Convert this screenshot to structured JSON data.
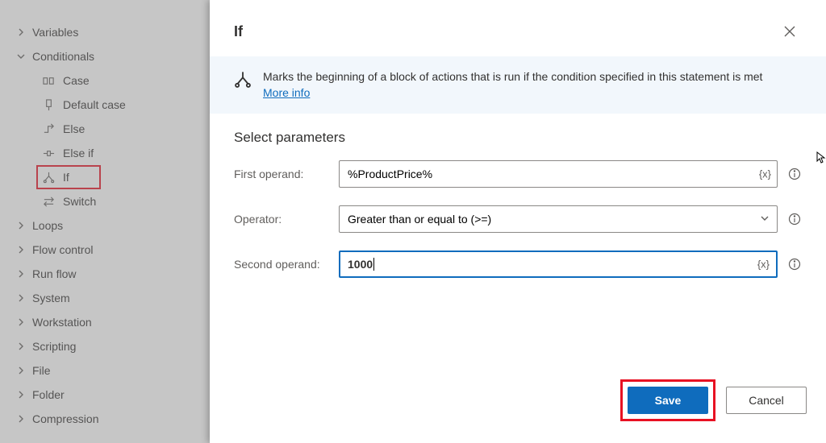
{
  "sidebar": {
    "items": [
      {
        "label": "Variables",
        "expanded": false
      },
      {
        "label": "Conditionals",
        "expanded": true,
        "children": [
          {
            "label": "Case",
            "icon": "case"
          },
          {
            "label": "Default case",
            "icon": "default"
          },
          {
            "label": "Else",
            "icon": "else"
          },
          {
            "label": "Else if",
            "icon": "elseif"
          },
          {
            "label": "If",
            "icon": "if",
            "highlight": true
          },
          {
            "label": "Switch",
            "icon": "switch"
          }
        ]
      },
      {
        "label": "Loops",
        "expanded": false
      },
      {
        "label": "Flow control",
        "expanded": false
      },
      {
        "label": "Run flow",
        "expanded": false
      },
      {
        "label": "System",
        "expanded": false
      },
      {
        "label": "Workstation",
        "expanded": false
      },
      {
        "label": "Scripting",
        "expanded": false
      },
      {
        "label": "File",
        "expanded": false
      },
      {
        "label": "Folder",
        "expanded": false
      },
      {
        "label": "Compression",
        "expanded": false
      }
    ]
  },
  "panel": {
    "title": "If",
    "description": "Marks the beginning of a block of actions that is run if the condition specified in this statement is met",
    "more_link": "More info",
    "section_title": "Select parameters",
    "fields": {
      "first_operand": {
        "label": "First operand:",
        "value": "%ProductPrice%",
        "badge": "{x}"
      },
      "operator": {
        "label": "Operator:",
        "value": "Greater than or equal to (>=)"
      },
      "second_operand": {
        "label": "Second operand:",
        "value": "1000",
        "badge": "{x}"
      }
    },
    "buttons": {
      "save": "Save",
      "cancel": "Cancel"
    }
  }
}
